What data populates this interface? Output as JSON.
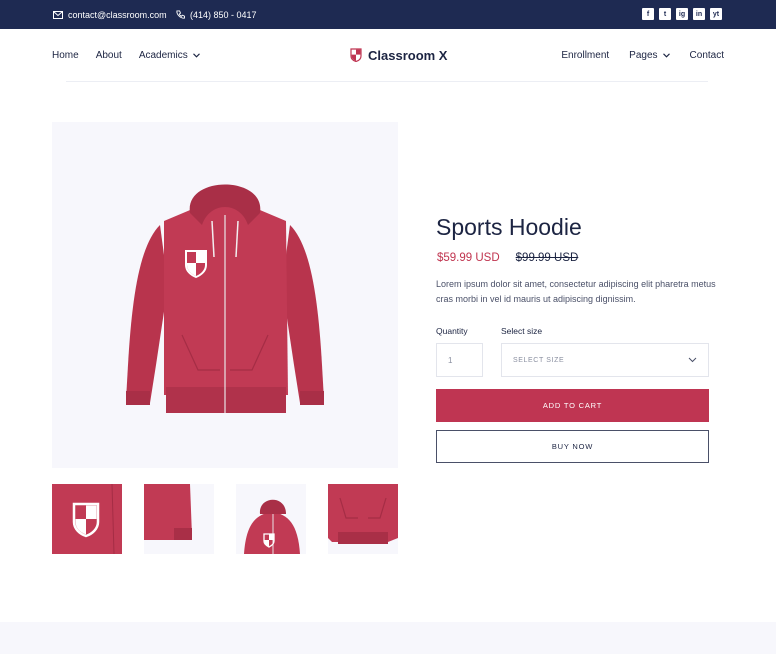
{
  "topbar": {
    "email": "contact@classroom.com",
    "phone": "(414) 850 - 0417",
    "social": [
      "f",
      "t",
      "ig",
      "in",
      "yt"
    ]
  },
  "nav": {
    "home": "Home",
    "about": "About",
    "academics": "Academics",
    "brand": "Classroom X",
    "enrollment": "Enrollment",
    "pages": "Pages",
    "contact": "Contact"
  },
  "product": {
    "title": "Sports Hoodie",
    "price": "$59.99 USD",
    "old_price": "$99.99 USD",
    "description": "Lorem ipsum dolor sit amet, consectetur adipiscing elit pharetra metus cras morbi in vel id mauris ut adipiscing dignissim."
  },
  "form": {
    "quantity_label": "Quantity",
    "quantity_value": "1",
    "size_label": "Select size",
    "size_placeholder": "SELECT SIZE",
    "add_to_cart": "ADD TO CART",
    "buy_now": "BUY NOW"
  },
  "colors": {
    "topbar": "#1e2a52",
    "accent": "#bf3552",
    "text": "#1c2442"
  },
  "icons": {
    "email": "envelope-icon",
    "phone": "phone-icon",
    "brand": "shield-logo-icon",
    "dropdown": "chevron-down-icon"
  }
}
